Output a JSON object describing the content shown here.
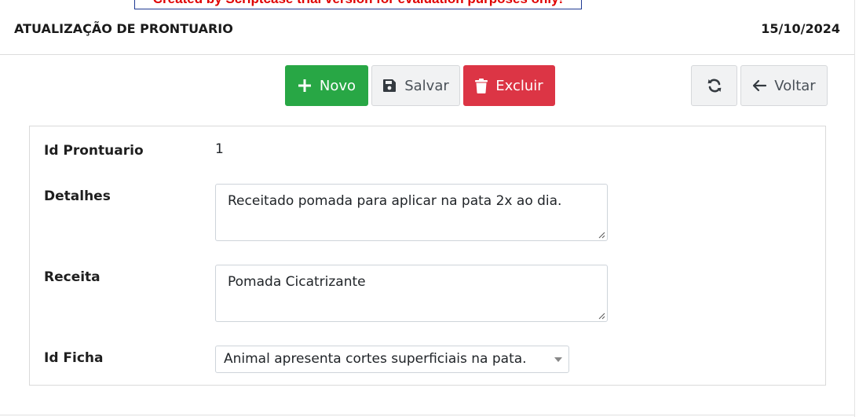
{
  "trial_banner": "Created by Scriptcase trial version for evaluation purposes only!",
  "header": {
    "title": "ATUALIZAÇÃO DE PRONTUARIO",
    "date": "15/10/2024"
  },
  "toolbar": {
    "novo_label": "Novo",
    "salvar_label": "Salvar",
    "excluir_label": "Excluir",
    "voltar_label": "Voltar",
    "icons": {
      "novo": "plus-icon",
      "salvar": "floppy-disk-icon",
      "excluir": "trash-icon",
      "refresh": "refresh-icon",
      "voltar": "arrow-left-icon"
    },
    "colors": {
      "novo": "#28a745",
      "excluir": "#dc3545",
      "neutral": "#f1f2f3"
    }
  },
  "form": {
    "id_prontuario": {
      "label": "Id Prontuario",
      "value": "1"
    },
    "detalhes": {
      "label": "Detalhes",
      "value": "Receitado pomada para aplicar na pata 2x ao dia."
    },
    "receita": {
      "label": "Receita",
      "value": "Pomada Cicatrizante"
    },
    "id_ficha": {
      "label": "Id Ficha",
      "selected": "Animal apresenta cortes superficiais na pata."
    }
  }
}
